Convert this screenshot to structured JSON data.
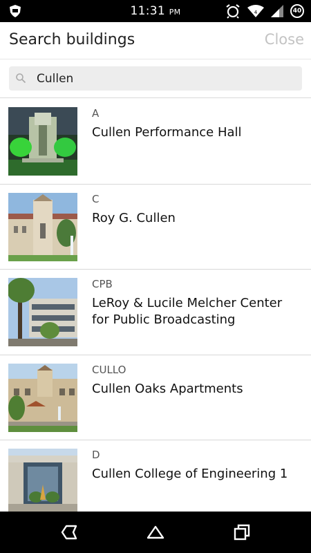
{
  "status_bar": {
    "time": "11:31",
    "ampm": "PM",
    "battery_level": "40"
  },
  "header": {
    "title": "Search buildings",
    "close_label": "Close"
  },
  "search": {
    "value": "Cullen"
  },
  "buildings": [
    {
      "code": "A",
      "name": "Cullen Performance Hall"
    },
    {
      "code": "C",
      "name": "Roy G. Cullen"
    },
    {
      "code": "CPB",
      "name": "LeRoy & Lucile Melcher Center for Public Broadcasting"
    },
    {
      "code": "CULLO",
      "name": "Cullen Oaks Apartments"
    },
    {
      "code": "D",
      "name": "Cullen College of Engineering 1"
    }
  ],
  "nav_bar": {
    "icons": [
      "back-icon",
      "home-icon",
      "recents-icon"
    ]
  }
}
